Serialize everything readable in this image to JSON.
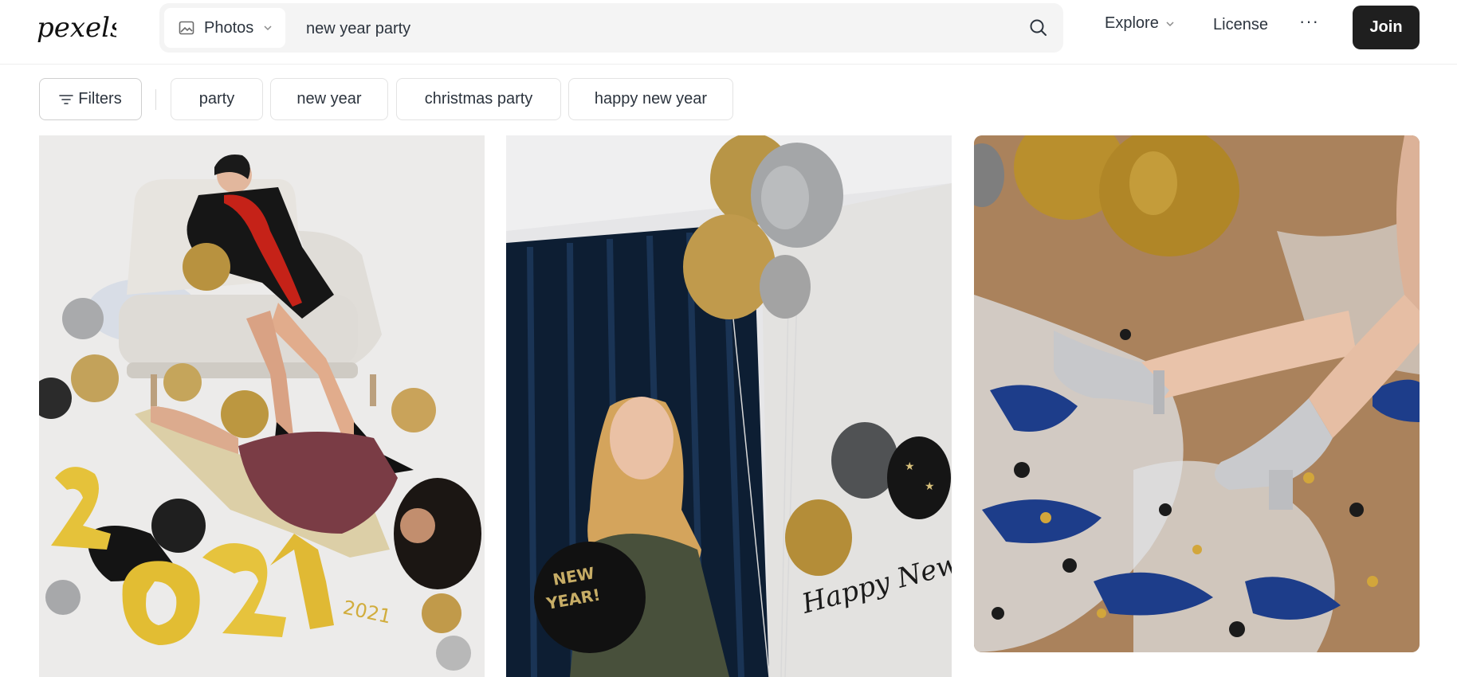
{
  "header": {
    "logo_text": "pexels",
    "search": {
      "type_label": "Photos",
      "query": "new year party"
    },
    "nav": {
      "explore": "Explore",
      "license": "License",
      "more": "···",
      "join": "Join"
    }
  },
  "filters": {
    "button_label": "Filters",
    "chips": [
      "party",
      "new year",
      "christmas party",
      "happy new year"
    ]
  },
  "photo_card_texts": {
    "photo2_balloon_text": "Happy NEW YEAR!",
    "photo2_banner_text": "Happy New Year"
  },
  "icons": {
    "logo": "pexels-logo",
    "type": "image-icon",
    "search": "search-icon",
    "chevron": "chevron-down-icon",
    "filters": "filter-lines-icon",
    "more": "more-dots-icon"
  },
  "colors": {
    "join_bg": "#1f1f1f",
    "search_bg": "#f4f4f4",
    "text": "#2c343e"
  }
}
